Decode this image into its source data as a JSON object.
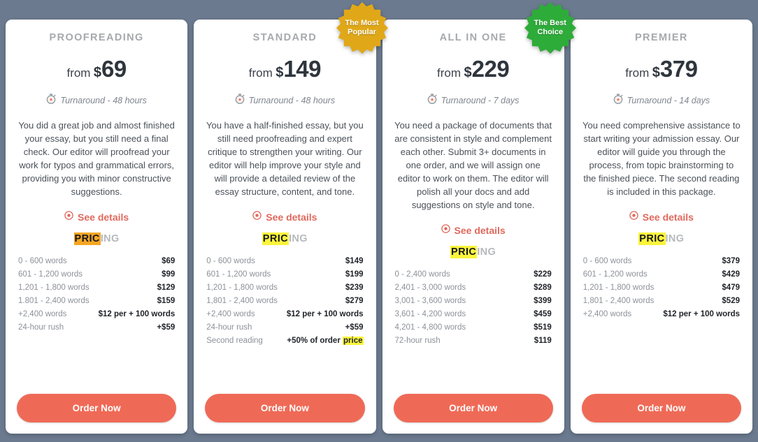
{
  "theme": {
    "page_background": "#6b7a8f",
    "card_background": "#ffffff",
    "accent_coral": "#ef6a56",
    "link_coral": "#e0685c",
    "highlight_yellow": "#fbf43c",
    "highlight_orange": "#f5a623",
    "badge_gold": "#e0a818",
    "badge_green": "#2eac3a"
  },
  "cards": [
    {
      "title": "PROOFREADING",
      "price_from_label": "from",
      "currency": "$",
      "amount": "69",
      "turnaround": "Turnaround - 48 hours",
      "turnaround_icon": "stopwatch-icon",
      "description": "You did a great job and almost finished your essay, but you still need a final check. Our editor will proofread your work for typos and grammatical errors, providing you with minor constructive suggestions.",
      "see_details_label": "See details",
      "see_details_icon": "eye-icon",
      "pricing_heading_highlighted": "PRIC",
      "pricing_heading_rest": "ING",
      "pricing_heading_highlight_color": "#f5a623",
      "rows": [
        {
          "label": "0 - 600 words",
          "value": "$69"
        },
        {
          "label": "601 - 1,200 words",
          "value": "$99"
        },
        {
          "label": "1,201 - 1,800 words",
          "value": "$129"
        },
        {
          "label": "1.801 - 2,400 words",
          "value": "$159"
        },
        {
          "label": "+2,400 words",
          "value": "$12 per + 100 words"
        },
        {
          "label": "24-hour rush",
          "value": "+$59"
        }
      ],
      "order_label": "Order Now",
      "badge": null
    },
    {
      "title": "STANDARD",
      "price_from_label": "from",
      "currency": "$",
      "amount": "149",
      "turnaround": "Turnaround - 48 hours",
      "turnaround_icon": "stopwatch-icon",
      "description": "You have a half-finished essay, but you still need proofreading and expert critique to strengthen your writing. Our editor will help improve your style and will provide a detailed review of the essay structure, content, and tone.",
      "see_details_label": "See details",
      "see_details_icon": "eye-icon",
      "pricing_heading_highlighted": "PRIC",
      "pricing_heading_rest": "ING",
      "pricing_heading_highlight_color": "#fbf43c",
      "rows": [
        {
          "label": "0 - 600 words",
          "value": "$149"
        },
        {
          "label": "601 - 1,200 words",
          "value": "$199"
        },
        {
          "label": "1,201 - 1,800 words",
          "value": "$239"
        },
        {
          "label": "1,801 - 2,400 words",
          "value": "$279"
        },
        {
          "label": "+2,400 words",
          "value": "$12 per + 100 words"
        },
        {
          "label": "24-hour rush",
          "value": "+$59"
        },
        {
          "label": "Second reading",
          "value": "+50% of order price",
          "value_highlight": "price"
        }
      ],
      "order_label": "Order Now",
      "badge": {
        "line1": "The Most",
        "line2": "Popular",
        "color": "#e0a818",
        "name": "most-popular-badge"
      }
    },
    {
      "title": "ALL IN ONE",
      "price_from_label": "from",
      "currency": "$",
      "amount": "229",
      "turnaround": "Turnaround - 7 days",
      "turnaround_icon": "stopwatch-icon",
      "description": "You need a package of documents that are consistent in style and complement each other. Submit 3+ documents in one order, and we will assign one editor to work on them. The editor will polish all your docs and add suggestions on style and tone.",
      "see_details_label": "See details",
      "see_details_icon": "eye-icon",
      "pricing_heading_highlighted": "PRIC",
      "pricing_heading_rest": "ING",
      "pricing_heading_highlight_color": "#fbf43c",
      "rows": [
        {
          "label": "0 - 2,400 words",
          "value": "$229"
        },
        {
          "label": "2,401 - 3,000 words",
          "value": "$289"
        },
        {
          "label": "3,001 - 3,600 words",
          "value": "$399"
        },
        {
          "label": "3,601 - 4,200 words",
          "value": "$459"
        },
        {
          "label": "4,201 - 4,800 words",
          "value": "$519"
        },
        {
          "label": "72-hour rush",
          "value": "$119"
        }
      ],
      "order_label": "Order Now",
      "badge": {
        "line1": "The Best",
        "line2": "Choice",
        "color": "#2eac3a",
        "name": "best-choice-badge"
      }
    },
    {
      "title": "PREMIER",
      "price_from_label": "from",
      "currency": "$",
      "amount": "379",
      "turnaround": "Turnaround - 14 days",
      "turnaround_icon": "stopwatch-icon",
      "description": "You need comprehensive assistance to start writing your admission essay. Our editor will guide you through the process, from topic brainstorming to the finished piece. The second reading is included in this package.",
      "see_details_label": "See details",
      "see_details_icon": "eye-icon",
      "pricing_heading_highlighted": "PRIC",
      "pricing_heading_rest": "ING",
      "pricing_heading_highlight_color": "#fbf43c",
      "rows": [
        {
          "label": "0 - 600 words",
          "value": "$379"
        },
        {
          "label": "601 - 1,200 words",
          "value": "$429"
        },
        {
          "label": "1,201 - 1,800 words",
          "value": "$479"
        },
        {
          "label": "1,801 - 2,400 words",
          "value": "$529"
        },
        {
          "label": "+2,400 words",
          "value": "$12 per + 100 words"
        }
      ],
      "order_label": "Order Now",
      "badge": null
    }
  ]
}
